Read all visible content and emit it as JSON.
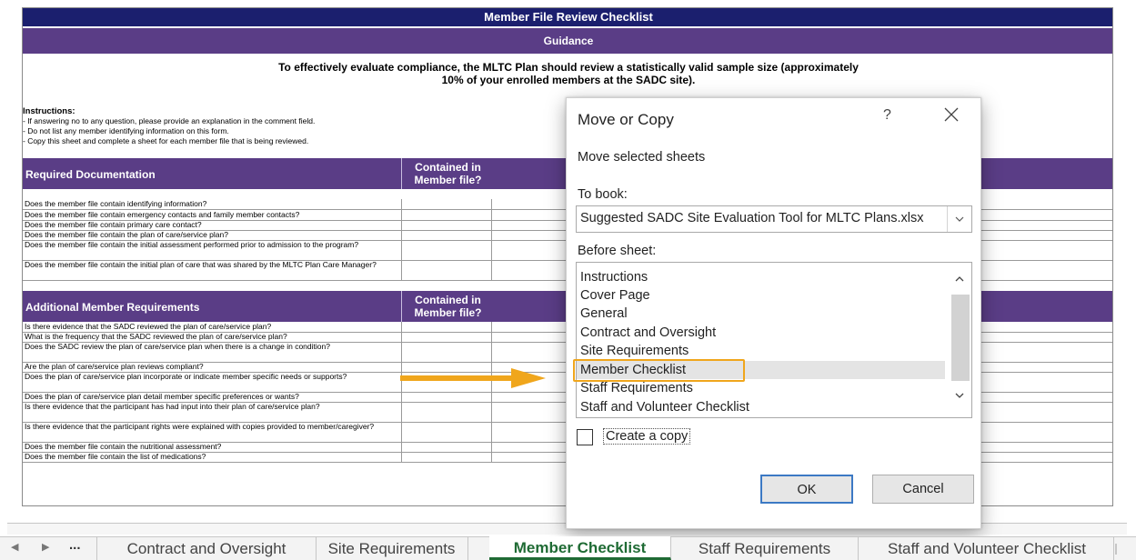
{
  "sheet": {
    "title": "Member File Review Checklist",
    "guidance": "Guidance",
    "intro_line1": "To effectively evaluate compliance, the MLTC Plan should review a statistically valid sample size (approximately",
    "intro_line2": "10% of your enrolled members at the SADC site).",
    "instructions_heading": "Instructions:",
    "instructions": [
      "- If answering no to any question, please provide an explanation in the comment field.",
      "- Do not list any member identifying information on this form.",
      "- Copy this sheet and complete a sheet for each member file that is being reviewed."
    ],
    "section1": {
      "title": "Required Documentation",
      "col1_line1": "Contained in",
      "col1_line2": "Member file?",
      "rows": [
        "Does the member file contain identifying information?",
        "Does the member file contain emergency contacts and family member contacts?",
        "Does the member file contain primary care contact?",
        "Does the member file contain the plan of care/service plan?",
        "Does the member file contain the initial assessment performed prior to admission to the program?",
        "Does the member file contain the initial plan of care that was shared by the MLTC Plan Care Manager?"
      ]
    },
    "section2": {
      "title": "Additional Member Requirements",
      "col1_line1": "Contained in",
      "col1_line2": "Member file?",
      "rows": [
        "Is there evidence that the SADC reviewed the plan of care/service plan?",
        "What is the frequency that the SADC reviewed the plan of care/service plan?",
        "Does the SADC review the plan of care/service plan when there is a change in condition?",
        "Are the plan of care/service plan reviews compliant?",
        "Does the plan of care/service plan incorporate or indicate member specific needs or supports?",
        "Does the plan of care/service plan detail member specific preferences or wants?",
        "Is there evidence that the participant has had input into their plan of care/service plan?",
        "Is there evidence that the participant rights were explained with copies provided to member/caregiver?",
        "Does the member file contain the nutritional assessment?",
        "Does the member file contain the list of medications?"
      ]
    }
  },
  "dialog": {
    "title": "Move or Copy",
    "help": "?",
    "subtitle": "Move selected sheets",
    "to_book_label": "To book:",
    "to_book_value": "Suggested SADC Site Evaluation Tool for MLTC Plans.xlsx",
    "before_sheet_label": "Before sheet:",
    "sheets": [
      "Instructions",
      "Cover Page",
      "General",
      "Contract and Oversight",
      "Site Requirements",
      "Member Checklist",
      "Staff Requirements",
      "Staff and Volunteer Checklist"
    ],
    "selected_sheet": "Member Checklist",
    "create_copy_label": "Create a copy",
    "create_copy_checked": false,
    "ok_label": "OK",
    "cancel_label": "Cancel"
  },
  "tabs": {
    "more": "...",
    "items": [
      "Contract and Oversight",
      "Site Requirements",
      "Member Checklist",
      "Staff Requirements",
      "Staff and Volunteer Checklist"
    ],
    "active": "Member Checklist",
    "active_color": "#1f6b34"
  },
  "colors": {
    "title_band": "#1b1f6e",
    "section_band": "#5a3d86",
    "highlight": "#f0a61c",
    "arrow": "#f0a61c"
  }
}
